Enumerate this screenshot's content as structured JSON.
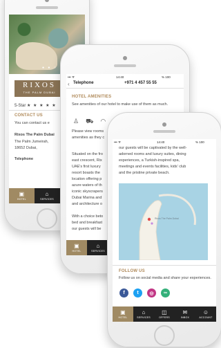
{
  "phone1": {
    "hero_dots": "● ● ○",
    "logo_title": "RIXOS",
    "logo_subtitle": "THE PALM DUBAI",
    "rating_label": "5-Star",
    "rating_stars": "★ ★ ★ ★ ★",
    "contact_title": "CONTACT US",
    "contact_text": "You can contact us e",
    "address_name": "Rixos The Palm Dubai",
    "address_line1": "The Palm Jumeirah,",
    "address_line2": "18652 Dubai,",
    "telephone_label": "Telephone",
    "tabs": [
      {
        "icon": "hotel-icon",
        "label": "HOTEL"
      },
      {
        "icon": "services-icon",
        "label": "SERVICES"
      },
      {
        "icon": "offers-icon",
        "label": "OF"
      }
    ]
  },
  "phone2": {
    "time": "14:40",
    "battery": "% 100",
    "telephone_label": "Telephone",
    "telephone_value": "+971 4 457 55 55",
    "amenities_title": "HOTEL AMENITIES",
    "amenities_text": "See amenities of our hotel to make use of them as much.",
    "rooms_text": "Please view rooms",
    "rooms_text2": "amenities as they c",
    "desc": [
      "Situated on the fro",
      "east crescent, Rix",
      "UAE's first luxury",
      "resort boasts the",
      "location offering p",
      "azure waters of th",
      "iconic skyscrapers",
      "Dubai Marina and",
      "and architecture o"
    ],
    "desc2": [
      "With a choice beto",
      "bed and breakfast",
      "our guests will be"
    ],
    "tabs": [
      {
        "icon": "hotel-icon",
        "label": "HOTEL"
      },
      {
        "icon": "services-icon",
        "label": "SERVICES"
      }
    ]
  },
  "phone3": {
    "time": "14:40",
    "battery": "% 100",
    "top_text": [
      "our guests will be captivated by the well-",
      "adorned rooms and luxury suites, dining",
      "experiences, a Turkish-inspired spa,",
      "meetings and events facilities, kids' club",
      "and the pristine private beach."
    ],
    "map_label": "Rixos The Palm Dubai",
    "follow_title": "FOLLOW US",
    "follow_text": "Follow us on social media and share your experiences.",
    "social": [
      {
        "name": "facebook",
        "glyph": "f",
        "color": "#3b5998"
      },
      {
        "name": "twitter",
        "glyph": "t",
        "color": "#1da1f2"
      },
      {
        "name": "instagram",
        "glyph": "◎",
        "color": "#c13584"
      },
      {
        "name": "tripadvisor",
        "glyph": "∞",
        "color": "#34b07a"
      }
    ],
    "tabs": [
      {
        "icon": "hotel-icon",
        "label": "HOTEL"
      },
      {
        "icon": "services-icon",
        "label": "SERVICES"
      },
      {
        "icon": "offers-icon",
        "label": "OFFERS"
      },
      {
        "icon": "inbox-icon",
        "label": "INBOX"
      },
      {
        "icon": "account-icon",
        "label": "ACCOUNT"
      }
    ]
  },
  "colors": {
    "accent": "#a08a63",
    "tabbar": "#222222",
    "map_water": "#a8d3e4"
  }
}
